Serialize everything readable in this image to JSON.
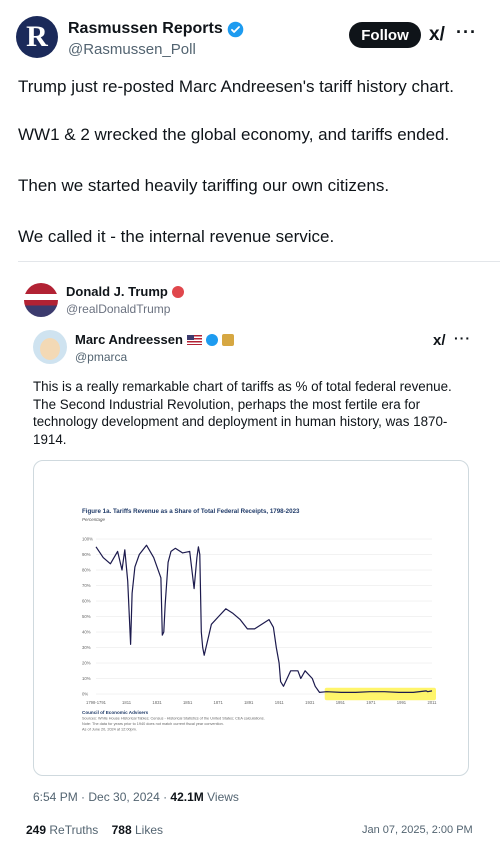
{
  "outer_post": {
    "display_name": "Rasmussen Reports",
    "handle": "@Rasmussen_Poll",
    "avatar_letter": "R",
    "follow_label": "Follow",
    "paragraphs": [
      "Trump just re-posted Marc Andreesen's tariff history chart.",
      "WW1 & 2 wrecked the global economy, and tariffs ended.",
      "Then we started heavily tariffing our own citizens.",
      "We called it - the internal revenue service."
    ]
  },
  "truth_post": {
    "display_name": "Donald J. Trump",
    "handle": "@realDonaldTrump"
  },
  "inner_post": {
    "display_name": "Marc Andreessen",
    "handle": "@pmarca",
    "text": "This is a really remarkable chart of tariffs as % of total federal revenue. The Second Industrial Revolution, perhaps the most fertile era for technology development and deployment in human history, was 1870-1914.",
    "time": "6:54 PM · Dec 30, 2024 ·",
    "views_count": "42.1M",
    "views_label": "Views"
  },
  "footer": {
    "retruths_count": "249",
    "retruths_label": "ReTruths",
    "likes_count": "788",
    "likes_label": "Likes",
    "date": "Jan 07, 2025, 2:00 PM"
  },
  "chart_data": {
    "type": "line",
    "title": "Figure 1a. Tariffs Revenue as a Share of Total Federal Receipts, 1798-2023",
    "ylabel": "Percentage",
    "ylim": [
      0,
      100
    ],
    "yticks": [
      "0%",
      "10%",
      "20%",
      "30%",
      "40%",
      "50%",
      "60%",
      "70%",
      "80%",
      "90%",
      "100%"
    ],
    "xticks": [
      "1798-1791",
      "1811",
      "1831",
      "1851",
      "1871",
      "1891",
      "1911",
      "1931",
      "1951",
      "1971",
      "1991",
      "2011"
    ],
    "xlim": [
      1790,
      2023
    ],
    "series": [
      {
        "x": [
          1790,
          1795,
          1800,
          1805,
          1808,
          1810,
          1812,
          1814,
          1815,
          1817,
          1820,
          1825,
          1830,
          1835,
          1836,
          1837,
          1838,
          1840,
          1842,
          1845,
          1850,
          1855,
          1858,
          1860,
          1861,
          1862,
          1863,
          1864,
          1865,
          1870,
          1875,
          1880,
          1885,
          1890,
          1895,
          1900,
          1905,
          1910,
          1913,
          1915,
          1917,
          1918,
          1920,
          1925,
          1930,
          1932,
          1935,
          1940,
          1942,
          1945,
          1950,
          1960,
          1970,
          1980,
          1990,
          2000,
          2010,
          2019,
          2020,
          2023
        ],
        "y": [
          95,
          88,
          84,
          92,
          80,
          93,
          73,
          32,
          65,
          82,
          90,
          96,
          88,
          75,
          38,
          40,
          58,
          85,
          92,
          94,
          91,
          92,
          68,
          88,
          95,
          90,
          40,
          30,
          25,
          45,
          50,
          55,
          52,
          48,
          42,
          42,
          45,
          48,
          43,
          30,
          20,
          8,
          5,
          15,
          15,
          10,
          15,
          10,
          5,
          1,
          1.5,
          1,
          1,
          1.5,
          1.5,
          1,
          1,
          2,
          1.5,
          2
        ]
      }
    ],
    "highlight_x_range": [
      1950,
      2023
    ],
    "notes": [
      "Council of Economic Advisers",
      "Sources: White House Historical Tables; Census - Historical Statistics of the United States; CEA calculations.",
      "Note: The data for years prior to 1940 does not match current fiscal year convention.",
      "As of June 20, 2024 at 12:00pm."
    ]
  }
}
